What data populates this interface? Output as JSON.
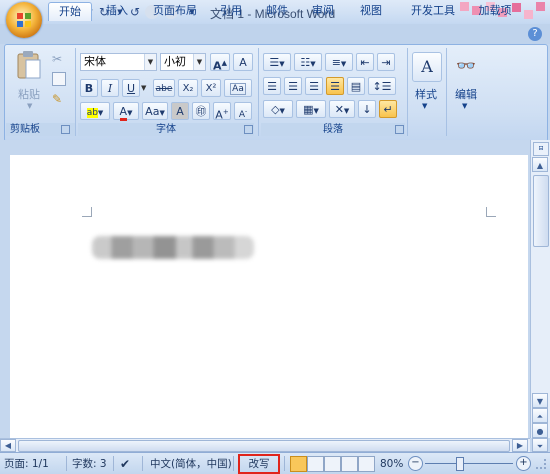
{
  "window": {
    "title": "文档 1 - Microsoft Word"
  },
  "quick_access": {
    "save_icon": "save-icon",
    "undo_icon": "undo-icon",
    "redo_icon": "redo-icon"
  },
  "tabs": [
    {
      "label": "开始",
      "active": true
    },
    {
      "label": "插入"
    },
    {
      "label": "页面布局"
    },
    {
      "label": "引用"
    },
    {
      "label": "邮件"
    },
    {
      "label": "审阅"
    },
    {
      "label": "视图"
    },
    {
      "label": "开发工具"
    },
    {
      "label": "加载项"
    }
  ],
  "ribbon": {
    "clipboard": {
      "paste_label": "粘贴",
      "group_label": "剪贴板"
    },
    "font": {
      "font_name": "宋体",
      "font_size": "小初",
      "bold": "B",
      "italic": "I",
      "underline": "U",
      "strike": "abe",
      "subscript": "X₂",
      "superscript": "X²",
      "grow": "A",
      "shrink": "A",
      "change_case": "Aa",
      "char_border": "A",
      "group_label": "字体"
    },
    "paragraph": {
      "group_label": "段落"
    },
    "styles": {
      "label": "样式"
    },
    "editing": {
      "label": "编辑"
    }
  },
  "status": {
    "page": "页面: 1/1",
    "words": "字数: 3",
    "language": "中文(简体，中国)",
    "overtype": "改写",
    "zoom": "80%"
  },
  "colors": {
    "highlight_border": "#e0241b",
    "ribbon_text": "#15428b"
  }
}
